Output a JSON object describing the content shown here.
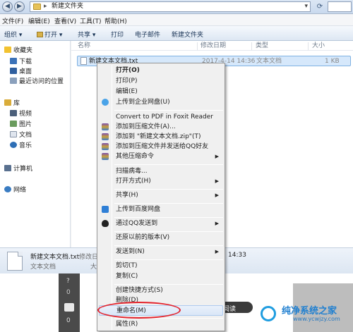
{
  "address_bar": {
    "path": "新建文件夹",
    "back_symbol": "◀",
    "forward_symbol": "▶",
    "dropdown_symbol": "▾",
    "refresh_symbol": "⟳"
  },
  "menu_bar": [
    "文件(F)",
    "编辑(E)",
    "查看(V)",
    "工具(T)",
    "帮助(H)"
  ],
  "toolbar": {
    "organize": "组织 ▾",
    "open": "打开 ▾",
    "share": "共享 ▾",
    "print": "打印",
    "email": "电子邮件",
    "new_folder": "新建文件夹"
  },
  "nav_pane": {
    "favorites": "收藏夹",
    "downloads": "下载",
    "desktop": "桌面",
    "recent": "最近访问的位置",
    "libraries": "库",
    "videos": "视频",
    "pictures": "图片",
    "documents": "文档",
    "music": "音乐",
    "computer": "计算机",
    "network": "网络"
  },
  "file_list": {
    "columns": {
      "name": "名称",
      "modified": "修改日期",
      "type": "类型",
      "size": "大小"
    },
    "file": {
      "name": "新建文本文档.txt",
      "modified": "2017-4-14 14:36",
      "type": "文本文档",
      "size": "1 KB"
    }
  },
  "details_pane": {
    "filename": "新建文本文档.txt",
    "modified_label": "修改日期",
    "filetype": "文本文档",
    "size_label": "大小",
    "time_fragment": "14:33"
  },
  "context_menu": {
    "open": "打开(O)",
    "print": "打印(P)",
    "edit": "编辑(E)",
    "upload_enterprise": "上传到企业网盘(U)",
    "convert_pdf": "Convert to PDF in Foxit Reader",
    "add_archive": "添加到压缩文件(A)...",
    "add_zip": "添加到 \"新建文本文档.zip\"(T)",
    "add_zip_qq": "添加到压缩文件并发送给QQ好友",
    "other_compress": "其他压缩命令",
    "scan_virus": "扫描病毒...",
    "open_with": "打开方式(H)",
    "share": "共享(H)",
    "upload_baidu": "上传到百度网盘",
    "send_qq": "通过QQ发送到",
    "restore_prev": "还原以前的版本(V)",
    "send_to": "发送到(N)",
    "cut": "剪切(T)",
    "copy": "复制(C)",
    "create_shortcut": "创建快捷方式(S)",
    "delete": "删除(D)",
    "rename": "重命名(M)",
    "properties": "属性(R)",
    "submenu_arrow": "▶"
  },
  "background_page": {
    "read_button": "阅读",
    "like_count": "0",
    "left_char": "0",
    "left_top_char": "?",
    "logo_text": "纯净系统之家",
    "logo_url": "www.ycwjzy.com"
  },
  "colors": {
    "highlight": "#d9e6f7",
    "annotation_circle": "#e3212b"
  }
}
